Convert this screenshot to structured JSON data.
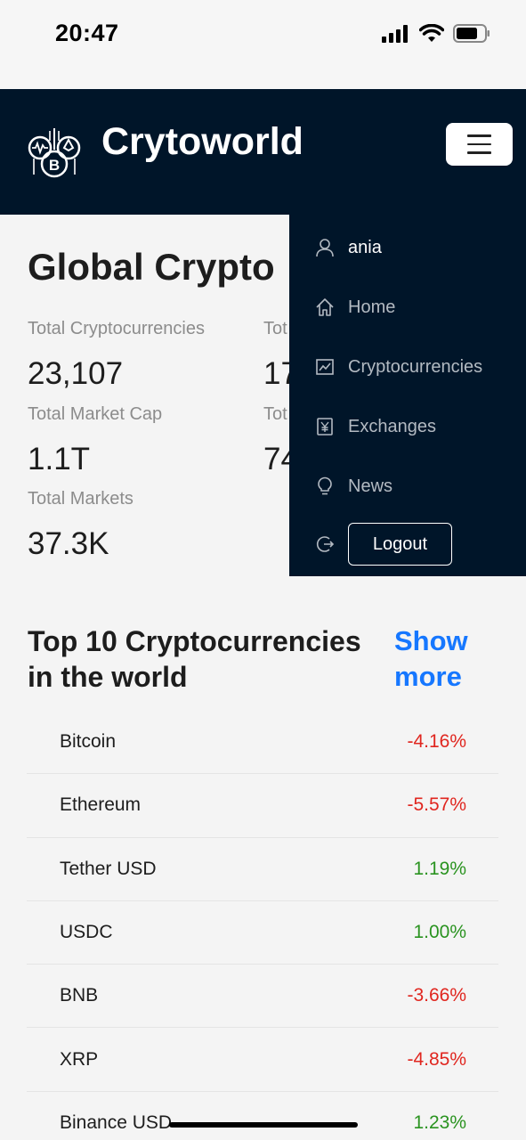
{
  "status_bar": {
    "time": "20:47"
  },
  "header": {
    "title": "Crytoworld"
  },
  "main": {
    "title": "Global Crypto",
    "stats": [
      {
        "label": "Total Cryptocurrencies",
        "value": "23,107"
      },
      {
        "label": "Total Market Cap",
        "value": "1.1T"
      },
      {
        "label": "Total Markets",
        "value": "37.3K"
      },
      {
        "label": "Tot",
        "value": "17"
      },
      {
        "label": "Tot",
        "value": "74"
      }
    ]
  },
  "top10": {
    "title": "Top 10 Cryptocurrencies in the world",
    "show_more": "Show more",
    "coins": [
      {
        "name": "Bitcoin",
        "change": "-4.16%",
        "trend": "negative"
      },
      {
        "name": "Ethereum",
        "change": "-5.57%",
        "trend": "negative"
      },
      {
        "name": "Tether USD",
        "change": "1.19%",
        "trend": "positive"
      },
      {
        "name": "USDC",
        "change": "1.00%",
        "trend": "positive"
      },
      {
        "name": "BNB",
        "change": "-3.66%",
        "trend": "negative"
      },
      {
        "name": "XRP",
        "change": "-4.85%",
        "trend": "negative"
      },
      {
        "name": "Binance USD",
        "change": "1.23%",
        "trend": "positive"
      }
    ]
  },
  "nav_menu": {
    "items": [
      {
        "label": "ania",
        "icon": "user-icon"
      },
      {
        "label": "Home",
        "icon": "home-icon"
      },
      {
        "label": "Cryptocurrencies",
        "icon": "chart-icon"
      },
      {
        "label": "Exchanges",
        "icon": "exchange-icon"
      },
      {
        "label": "News",
        "icon": "bulb-icon"
      }
    ],
    "logout_label": "Logout",
    "logout_icon": "logout-icon"
  },
  "colors": {
    "header_bg": "#001529",
    "accent": "#1677ff",
    "negative": "#e0261f",
    "positive": "#2a9320"
  }
}
